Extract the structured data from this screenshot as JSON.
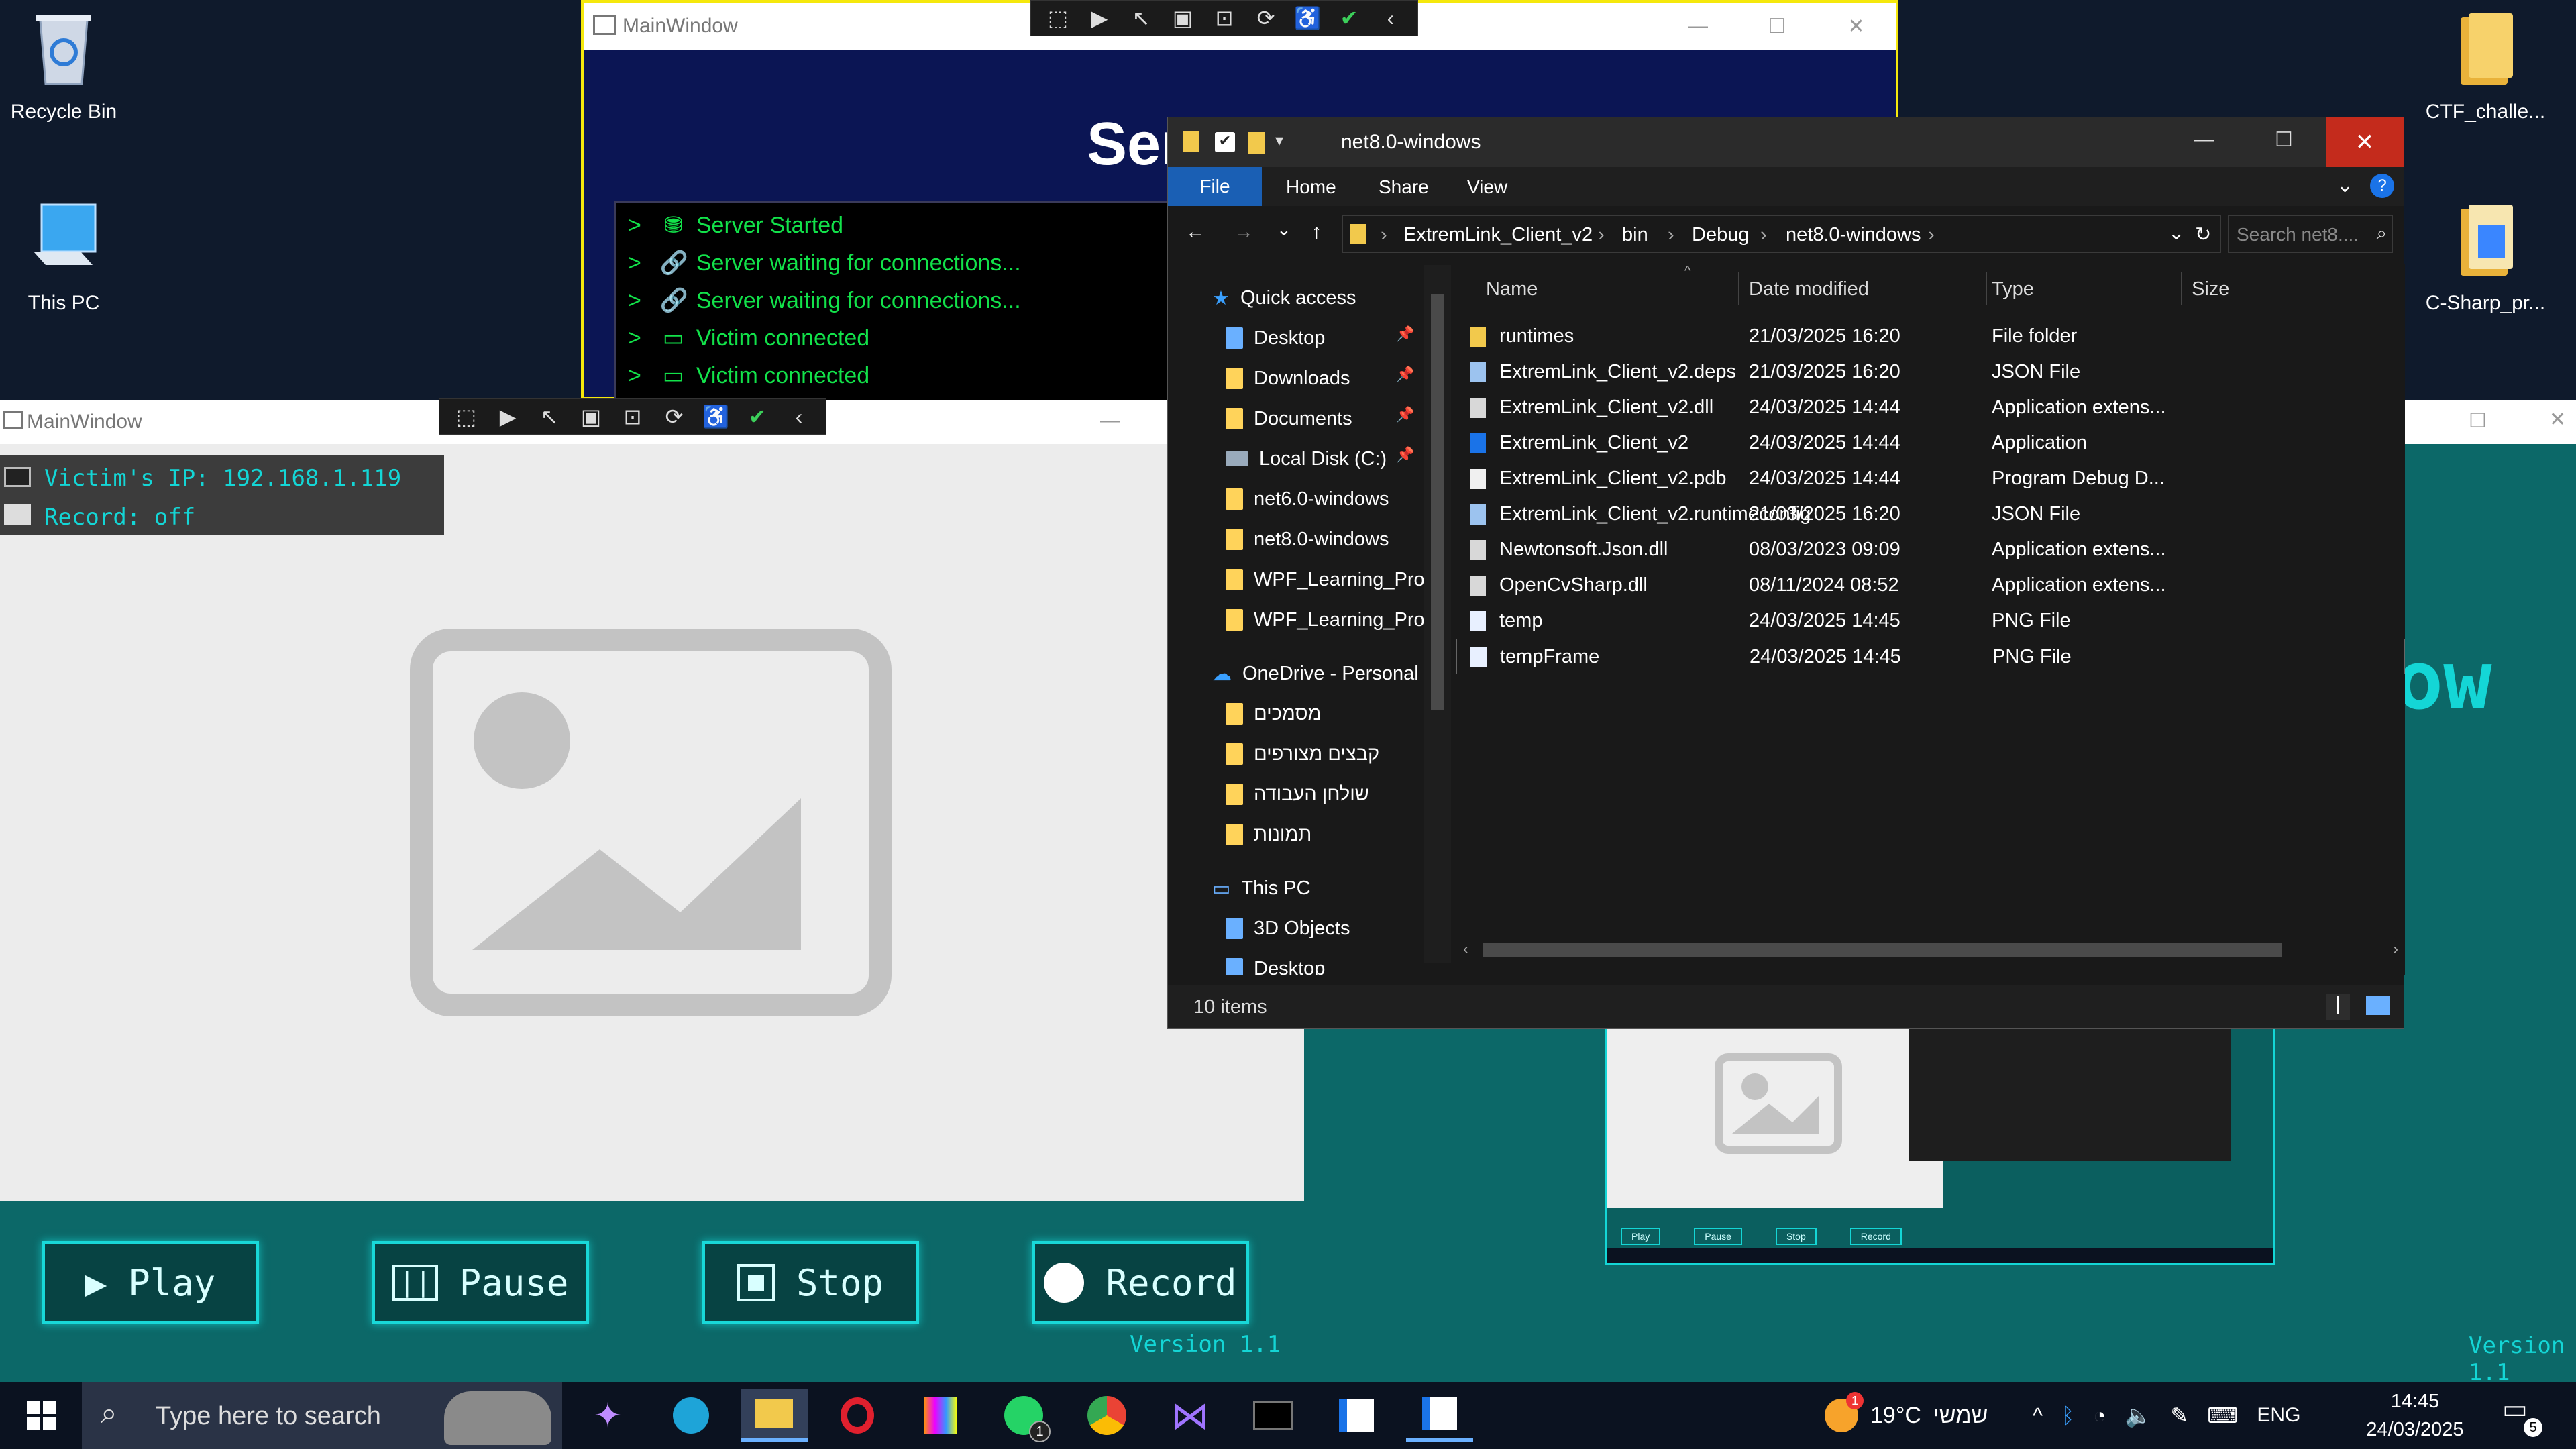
{
  "desktop": {
    "icons": [
      {
        "label": "Recycle Bin"
      },
      {
        "label": "This PC"
      },
      {
        "label": "CTF_challe..."
      },
      {
        "label": "C-Sharp_pr..."
      }
    ]
  },
  "server_window": {
    "title": "MainWindow",
    "heading": "Ser",
    "log": [
      "Server Started",
      "Server waiting for connections...",
      "Server waiting for connections...",
      "Victim connected",
      "Victim connected"
    ]
  },
  "client_window": {
    "title": "MainWindow",
    "ip_line": "Victim's IP: 192.168.1.119",
    "record_line": "Record: off",
    "buttons": {
      "play": "Play",
      "pause": "Pause",
      "stop": "Stop",
      "record": "Record"
    },
    "version": "Version 1.1"
  },
  "right_window": {
    "heading_frag": "ow",
    "version": "Version 1.1",
    "thumb_buttons": [
      "Play",
      "Pause",
      "Stop",
      "Record"
    ]
  },
  "explorer": {
    "title": "net8.0-windows",
    "ribbon": [
      "File",
      "Home",
      "Share",
      "View"
    ],
    "breadcrumb": [
      "ExtremLink_Client_v2",
      "bin",
      "Debug",
      "net8.0-windows"
    ],
    "search_placeholder": "Search net8....",
    "nav": [
      "Quick access",
      "Desktop",
      "Downloads",
      "Documents",
      "Local Disk (C:)",
      "net6.0-windows",
      "net8.0-windows",
      "WPF_Learning_Proj",
      "WPF_Learning_Proj",
      "OneDrive - Personal",
      "מסמכים",
      "קבצים מצורפים",
      "שולחן העבודה",
      "תמונות",
      "This PC",
      "3D Objects",
      "Desktop"
    ],
    "columns": [
      "Name",
      "Date modified",
      "Type",
      "Size"
    ],
    "files": [
      {
        "name": "runtimes",
        "date": "21/03/2025 16:20",
        "type": "File folder",
        "icon": "folder-icon"
      },
      {
        "name": "ExtremLink_Client_v2.deps",
        "date": "21/03/2025 16:20",
        "type": "JSON File",
        "icon": "json-file-icon"
      },
      {
        "name": "ExtremLink_Client_v2.dll",
        "date": "24/03/2025 14:44",
        "type": "Application extens...",
        "icon": "dll-file-icon"
      },
      {
        "name": "ExtremLink_Client_v2",
        "date": "24/03/2025 14:44",
        "type": "Application",
        "icon": "app-icon"
      },
      {
        "name": "ExtremLink_Client_v2.pdb",
        "date": "24/03/2025 14:44",
        "type": "Program Debug D...",
        "icon": "file-icon"
      },
      {
        "name": "ExtremLink_Client_v2.runtimeconfig",
        "date": "21/03/2025 16:20",
        "type": "JSON File",
        "icon": "json-file-icon"
      },
      {
        "name": "Newtonsoft.Json.dll",
        "date": "08/03/2023 09:09",
        "type": "Application extens...",
        "icon": "dll-file-icon"
      },
      {
        "name": "OpenCvSharp.dll",
        "date": "08/11/2024 08:52",
        "type": "Application extens...",
        "icon": "dll-file-icon"
      },
      {
        "name": "temp",
        "date": "24/03/2025 14:45",
        "type": "PNG File",
        "icon": "png-file-icon"
      },
      {
        "name": "tempFrame",
        "date": "24/03/2025 14:45",
        "type": "PNG File",
        "icon": "png-file-icon"
      }
    ],
    "status": "10 items"
  },
  "taskbar": {
    "search_placeholder": "Type here to search",
    "weather": "19°C",
    "weather_text": "שמשי",
    "lang": "ENG",
    "time": "14:45",
    "date": "24/03/2025",
    "notif_count": "5",
    "whatsapp_badge": "1",
    "weather_badge": "1"
  }
}
